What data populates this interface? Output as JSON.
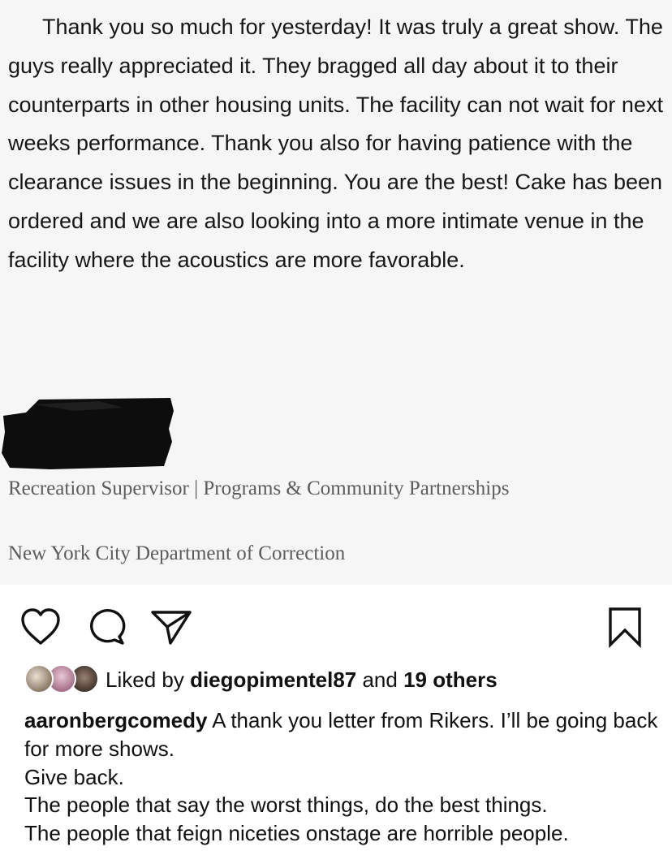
{
  "letter": {
    "body": "Thank you so much for yesterday! It was truly a great show. The guys really appreciated it. They bragged all day about it to their counterparts in other housing units. The facility can not wait for next weeks performance. Thank you also for having patience with the clearance issues in the beginning. You are the best! Cake has been ordered and we are also looking into a more intimate venue in the facility where the acoustics are more favorable.",
    "signature_title": "Recreation Supervisor | Programs & Community Partnerships",
    "signature_org": "New York City Department of Correction"
  },
  "actions": {
    "like_icon": "heart-outline-icon",
    "comment_icon": "speech-bubble-icon",
    "share_icon": "paper-plane-icon",
    "save_icon": "bookmark-icon"
  },
  "likes": {
    "prefix": "Liked by",
    "user": "diegopimentel87",
    "conjunction": "and",
    "others": "19 others"
  },
  "caption": {
    "username": "aaronbergcomedy",
    "lines": [
      "A thank you letter from Rikers.  I’ll be going back for more shows.",
      "Give back.",
      "The people that say the worst things, do the best things.",
      "The people that feign niceties onstage are horrible people."
    ]
  },
  "colors": {
    "text": "#111111",
    "letter_sig_text": "#5c5c5c",
    "redaction": "#0d0d0d"
  }
}
